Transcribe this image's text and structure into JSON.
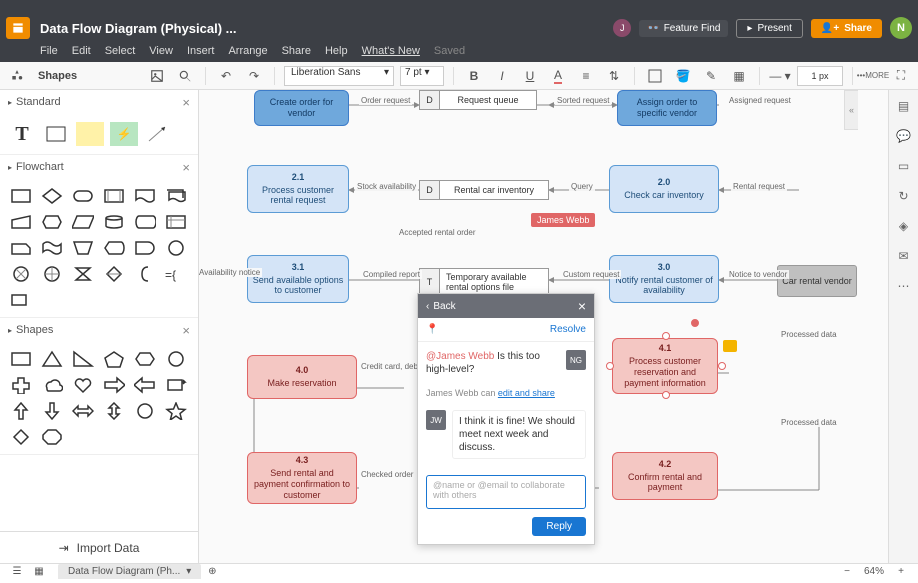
{
  "doc_title": "Data Flow Diagram (Physical) ...",
  "menus": {
    "file": "File",
    "edit": "Edit",
    "select": "Select",
    "view": "View",
    "insert": "Insert",
    "arrange": "Arrange",
    "share": "Share",
    "help": "Help",
    "whatsnew": "What's New",
    "saved": "Saved"
  },
  "header": {
    "feature_find": "Feature Find",
    "present": "Present",
    "share": "Share",
    "user_initial": "N",
    "collab_initial": "J"
  },
  "toolbar": {
    "shapes_label": "Shapes",
    "font": "Liberation Sans",
    "fontsize": "7 pt",
    "linewidth": "1 px",
    "more": "MORE"
  },
  "left": {
    "standard": "Standard",
    "flowchart": "Flowchart",
    "shapes": "Shapes",
    "import": "Import Data"
  },
  "canvas": {
    "cursor_user": "James Webb",
    "nodes": {
      "n11": {
        "num": "",
        "label": "Create order for vendor"
      },
      "n12": {
        "num": "",
        "label": "Assign order to specific vendor"
      },
      "n21": {
        "num": "2.1",
        "label": "Process customer rental request"
      },
      "n20": {
        "num": "2.0",
        "label": "Check car inventory"
      },
      "n31": {
        "num": "3.1",
        "label": "Send available options to customer"
      },
      "n30": {
        "num": "3.0",
        "label": "Notify rental customer of availability"
      },
      "n40": {
        "num": "4.0",
        "label": "Make reservation"
      },
      "n41": {
        "num": "4.1",
        "label": "Process customer reservation and payment information"
      },
      "n43": {
        "num": "4.3",
        "label": "Send rental and payment confirmation to customer"
      },
      "n42": {
        "num": "4.2",
        "label": "Confirm rental and payment"
      },
      "vendor": {
        "label": "Car rental vendor"
      }
    },
    "datastores": {
      "d1": {
        "id": "D",
        "label": "Request queue"
      },
      "d2": {
        "id": "D",
        "label": "Rental car inventory"
      },
      "t1": {
        "id": "T",
        "label": "Temporary available rental options file"
      }
    },
    "edges": {
      "order_req": "Order request",
      "sorted_req": "Sorted request",
      "assigned_req": "Assigned request",
      "stock_avail": "Stock availability",
      "query": "Query",
      "rental_req": "Rental request",
      "accepted": "Accepted rental order",
      "avail_notice": "Availability notice",
      "compiled": "Compiled report",
      "custom_req": "Custom request",
      "notice_to_vendor": "Notice to vendor",
      "credit": "Credit card, debit card, or cash",
      "processed": "Processed data",
      "processed2": "Processed data",
      "checked": "Checked order"
    }
  },
  "comments": {
    "back": "Back",
    "resolve": "Resolve",
    "msg1_mention": "@James Webb",
    "msg1_text": " Is this too high-level?",
    "msg1_av": "NG",
    "perm_prefix": "James Webb can ",
    "perm_link": "edit and share",
    "msg2_av": "JW",
    "msg2_text": "I think it is fine! We should meet next week and discuss.",
    "placeholder": "@name or @email to collaborate with others",
    "reply": "Reply"
  },
  "status": {
    "tab": "Data Flow Diagram (Ph...",
    "zoom": "64%"
  }
}
